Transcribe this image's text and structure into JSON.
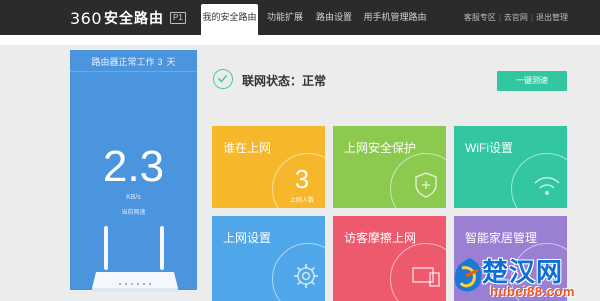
{
  "header": {
    "logo_number": "360",
    "logo_text": "安全路由",
    "logo_model": "P1",
    "tabs": [
      {
        "label": "我的安全路由",
        "active": true
      },
      {
        "label": "功能扩展",
        "active": false
      },
      {
        "label": "路由设置",
        "active": false
      },
      {
        "label": "用手机管理路由",
        "active": false
      }
    ],
    "links": [
      "客服专区",
      "去官网",
      "退出管理"
    ]
  },
  "status_panel": {
    "uptime_prefix": "路由器正常工作",
    "uptime_days": "3",
    "uptime_unit": "天",
    "speed_value": "2.3",
    "speed_unit": "KB/s",
    "speed_label": "当前网速",
    "background_color": "#4b94de"
  },
  "network": {
    "status_text": "联网状态：正常",
    "onekey_button": "一键测速",
    "accent_color": "#32c6a1"
  },
  "tiles": [
    {
      "title": "谁在上网",
      "color": "#f6b72a",
      "count": "3",
      "count_label": "上网人数",
      "icon": "user-count"
    },
    {
      "title": "上网安全保护",
      "color": "#8cc94f",
      "icon": "shield-plus-icon"
    },
    {
      "title": "WiFi设置",
      "color": "#33c6a2",
      "icon": "wifi-icon"
    },
    {
      "title": "上网设置",
      "color": "#4fa6e8",
      "icon": "gear-icon"
    },
    {
      "title": "访客摩擦上网",
      "color": "#ee5a6d",
      "icon": "guest-device-icon"
    },
    {
      "title": "智能家居管理",
      "color": "#9a7fd3",
      "icon": "home-icon"
    }
  ],
  "watermark": {
    "text": "楚汉网",
    "url": "hubei88.com"
  }
}
